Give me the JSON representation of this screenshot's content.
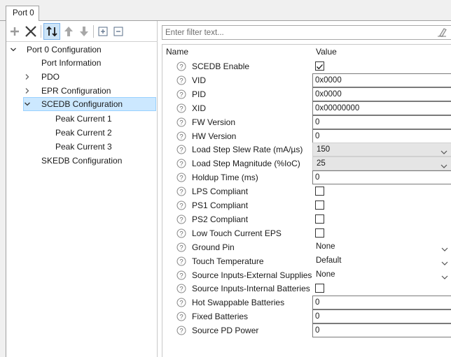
{
  "tab": {
    "label": "Port 0"
  },
  "tree": {
    "root": "Port 0 Configuration",
    "items": [
      {
        "label": "Port Information"
      },
      {
        "label": "PDO"
      },
      {
        "label": "EPR Configuration"
      },
      {
        "label": "SCEDB Configuration"
      },
      {
        "label": "Peak Current 1"
      },
      {
        "label": "Peak Current 2"
      },
      {
        "label": "Peak Current 3"
      },
      {
        "label": "SKEDB Configuration"
      }
    ]
  },
  "filter": {
    "placeholder": "Enter filter text..."
  },
  "grid": {
    "col_name": "Name",
    "col_value": "Value",
    "rows": [
      {
        "name": "SCEDB Enable",
        "type": "checkbox",
        "checked": true
      },
      {
        "name": "VID",
        "type": "text",
        "value": "0x0000"
      },
      {
        "name": "PID",
        "type": "text",
        "value": "0x0000"
      },
      {
        "name": "XID",
        "type": "text",
        "value": "0x00000000"
      },
      {
        "name": "FW Version",
        "type": "text",
        "value": "0"
      },
      {
        "name": "HW Version",
        "type": "text",
        "value": "0"
      },
      {
        "name": "Load Step Slew Rate (mA/µs)",
        "type": "combo",
        "value": "150"
      },
      {
        "name": "Load Step Magnitude (%IoC)",
        "type": "combo",
        "value": "25"
      },
      {
        "name": "Holdup Time (ms)",
        "type": "text",
        "value": "0"
      },
      {
        "name": "LPS Compliant",
        "type": "checkbox",
        "checked": false
      },
      {
        "name": "PS1 Compliant",
        "type": "checkbox",
        "checked": false
      },
      {
        "name": "PS2 Compliant",
        "type": "checkbox",
        "checked": false
      },
      {
        "name": "Low Touch Current EPS",
        "type": "checkbox",
        "checked": false
      },
      {
        "name": "Ground Pin",
        "type": "dropdown",
        "value": "None"
      },
      {
        "name": "Touch Temperature",
        "type": "dropdown",
        "value": "Default"
      },
      {
        "name": "Source Inputs-External Supplies",
        "type": "dropdown",
        "value": "None"
      },
      {
        "name": "Source Inputs-Internal Batteries",
        "type": "checkbox",
        "checked": false
      },
      {
        "name": "Hot Swappable Batteries",
        "type": "text",
        "value": "0"
      },
      {
        "name": "Fixed Batteries",
        "type": "text",
        "value": "0"
      },
      {
        "name": "Source PD Power",
        "type": "text",
        "value": "0"
      }
    ]
  }
}
